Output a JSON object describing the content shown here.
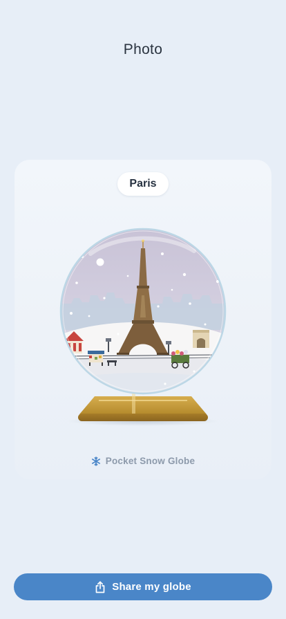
{
  "header": {
    "title": "Photo"
  },
  "card": {
    "city": "Paris",
    "brand": {
      "label": "Pocket Snow Globe",
      "icon": "snowflake-icon"
    }
  },
  "actions": {
    "share": {
      "label": "Share my globe",
      "icon": "share-icon"
    }
  },
  "colors": {
    "background": "#e7eef7",
    "accent": "#4a86c8",
    "globe_base": "#c69a3a",
    "tower": "#8a6a44"
  }
}
